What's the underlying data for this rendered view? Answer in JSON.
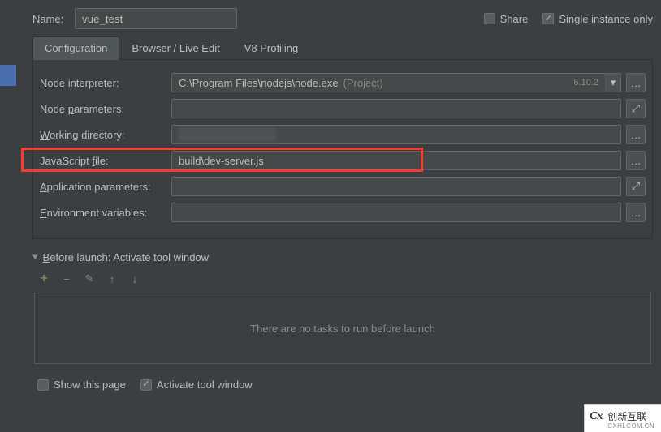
{
  "header": {
    "name_label_pre": "N",
    "name_label_post": "ame:",
    "name_value": "vue_test",
    "share_pre": "S",
    "share_post": "hare",
    "single_instance": "Single instance only",
    "share_checked": false,
    "single_checked": true
  },
  "tabs": {
    "configuration": "Configuration",
    "browser": "Browser / Live Edit",
    "v8": "V8 Profiling"
  },
  "fields": {
    "node_interpreter_pre": "N",
    "node_interpreter_post": "ode interpreter:",
    "node_interpreter_value": "C:\\Program Files\\nodejs\\node.exe",
    "node_interpreter_hint": "(Project)",
    "node_interpreter_version": "6.10.2",
    "node_parameters_pre": "Node ",
    "node_parameters_u": "p",
    "node_parameters_post": "arameters:",
    "working_dir_pre": "",
    "working_dir_u": "W",
    "working_dir_post": "orking directory:",
    "js_file_pre": "JavaScript ",
    "js_file_u": "f",
    "js_file_post": "ile:",
    "js_file_value": "build\\dev-server.js",
    "app_params_pre": "",
    "app_params_u": "A",
    "app_params_post": "pplication parameters:",
    "env_vars_pre": "",
    "env_vars_u": "E",
    "env_vars_post": "nvironment variables:"
  },
  "before_launch": {
    "title_pre": "",
    "title_u": "B",
    "title_post": "efore launch: Activate tool window",
    "empty_text": "There are no tasks to run before launch",
    "show_this_page": "Show this page",
    "activate_tool_window": "Activate tool window",
    "show_checked": false,
    "activate_checked": true
  },
  "watermark": {
    "text": "创新互联",
    "sub": "CXHLCOM.CN"
  }
}
